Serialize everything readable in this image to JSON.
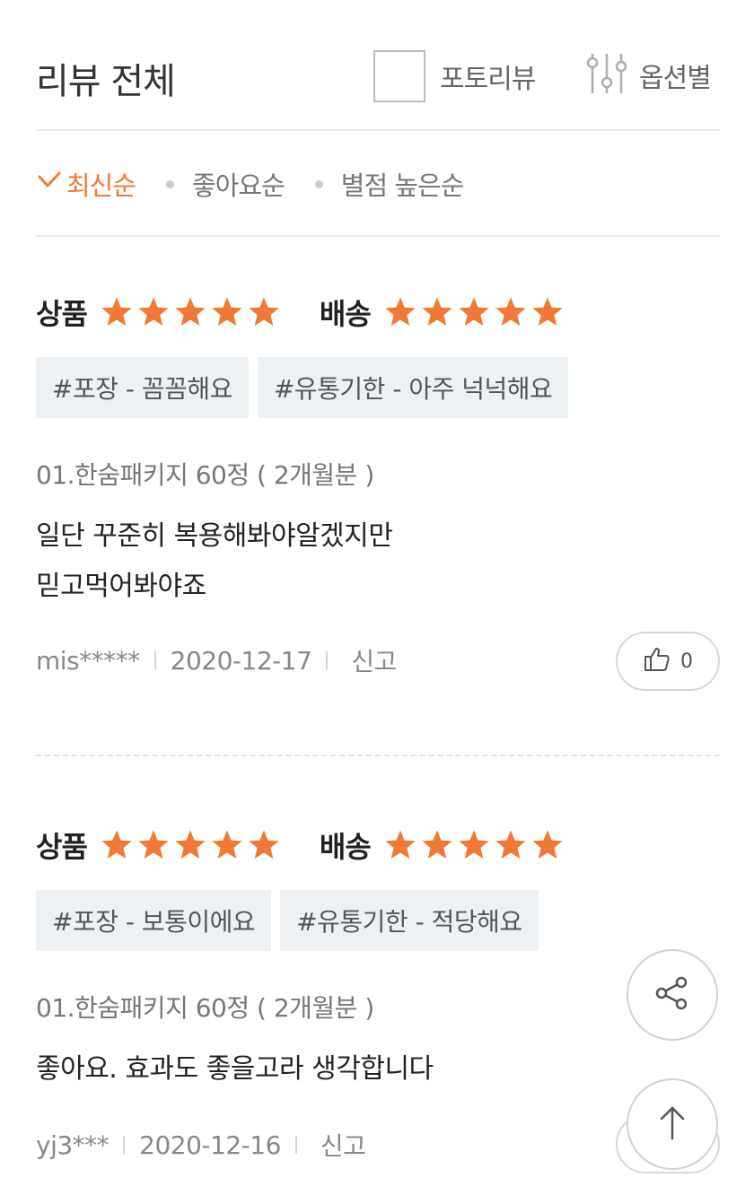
{
  "header": {
    "title": "리뷰 전체",
    "photo_review_label": "포토리뷰",
    "option_filter_label": "옵션별"
  },
  "sort": {
    "items": [
      {
        "label": "최신순",
        "active": true
      },
      {
        "label": "좋아요순",
        "active": false
      },
      {
        "label": "별점 높은순",
        "active": false
      }
    ]
  },
  "reviews": [
    {
      "product_label": "상품",
      "product_rating": 5,
      "delivery_label": "배송",
      "delivery_rating": 5,
      "tags": [
        "#포장 - 꼼꼼해요",
        "#유통기한 - 아주 넉넉해요"
      ],
      "option": "01.한숨패키지 60정 ( 2개월분 )",
      "content_line1": "일단 꾸준히 복용해봐야알겠지만",
      "content_line2": "믿고먹어봐야죠",
      "user": "mis*****",
      "date": "2020-12-17",
      "report_label": "신고",
      "likes": "0"
    },
    {
      "product_label": "상품",
      "product_rating": 5,
      "delivery_label": "배송",
      "delivery_rating": 5,
      "tags": [
        "#포장 - 보통이에요",
        "#유통기한 - 적당해요"
      ],
      "option": "01.한숨패키지 60정 ( 2개월분 )",
      "content_line1": "좋아요. 효과도 좋을고라 생각합니다",
      "user": "yj3***",
      "date": "2020-12-16",
      "report_label": "신고"
    }
  ],
  "colors": {
    "accent": "#f07a35",
    "star": "#f07a35",
    "tag_bg": "#eef1f4",
    "divider": "#e6e8eb"
  },
  "icons": {
    "sort_active": "check-icon",
    "filter": "sliders-icon",
    "like": "thumbs-up-icon",
    "share": "share-icon",
    "top": "arrow-up-icon"
  }
}
